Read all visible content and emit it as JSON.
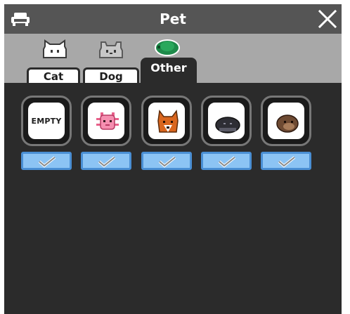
{
  "window": {
    "title": "Pet"
  },
  "tabs": [
    {
      "label": "Cat",
      "icon": "cat-head-icon",
      "active": false
    },
    {
      "label": "Dog",
      "icon": "dog-head-icon",
      "active": false
    },
    {
      "label": "Other",
      "icon": "turtle-head-icon",
      "active": true
    }
  ],
  "slots": [
    {
      "type": "empty",
      "label": "EMPTY",
      "equipped": true
    },
    {
      "type": "pet",
      "icon": "axolotl-icon",
      "equipped": true
    },
    {
      "type": "pet",
      "icon": "fox-icon",
      "equipped": true
    },
    {
      "type": "pet",
      "icon": "mole-icon",
      "equipped": true
    },
    {
      "type": "pet",
      "icon": "otter-icon",
      "equipped": true
    }
  ],
  "colors": {
    "titlebar": "#555555",
    "tabstrip": "#a8a8a8",
    "panel": "#2b2b2b",
    "equip_button": "#8cc4f4",
    "equip_border": "#4a8fd4"
  }
}
